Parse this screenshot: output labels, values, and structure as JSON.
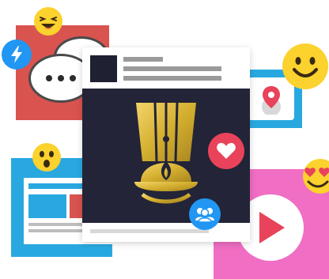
{
  "scene": {
    "description_icons": [
      "laugh-emoji-icon",
      "lightning-bolt-icon",
      "chat-bubble-icon",
      "smile-emoji-icon",
      "location-pin-icon",
      "surprised-emoji-icon",
      "heart-icon",
      "people-icon",
      "heart-eyes-emoji-icon",
      "play-icon",
      "fire-helmet-logo-icon"
    ]
  },
  "colors": {
    "red_card": "#d9534f",
    "blue_card": "#29a8e0",
    "pink_card": "#f06ec3",
    "dark_post": "#232437",
    "gold_logo": "#d4af2f",
    "emoji_yellow": "#fbd22e",
    "heart_red": "#e8435a",
    "badge_blue": "#2196f3"
  }
}
